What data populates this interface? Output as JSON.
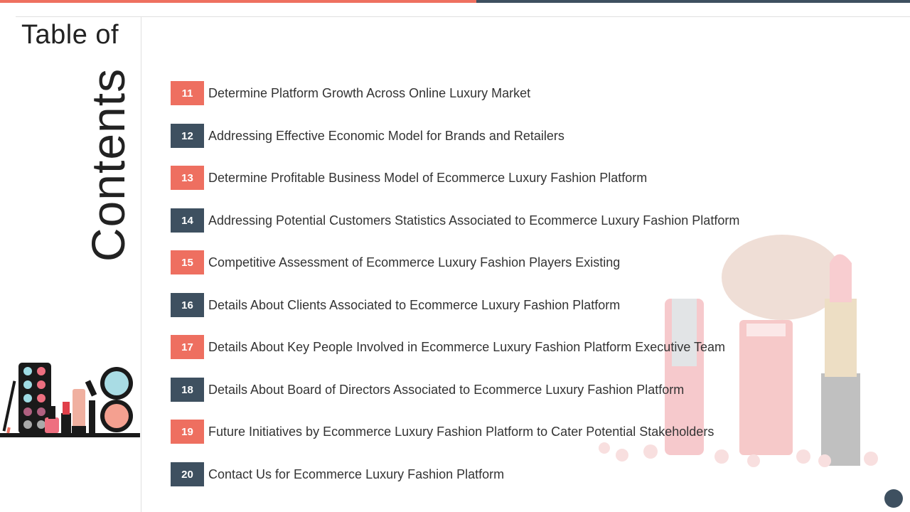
{
  "title": {
    "line1": "Table of",
    "line2": "Contents"
  },
  "colors": {
    "accent": "#ee6f60",
    "dark": "#3e5060"
  },
  "items": [
    {
      "num": "11",
      "text": "Determine Platform Growth Across Online Luxury Market",
      "color": "coral"
    },
    {
      "num": "12",
      "text": "Addressing Effective Economic Model for Brands and Retailers",
      "color": "navy"
    },
    {
      "num": "13",
      "text": "Determine Profitable Business Model of Ecommerce Luxury Fashion Platform",
      "color": "coral"
    },
    {
      "num": "14",
      "text": "Addressing Potential Customers Statistics Associated to Ecommerce Luxury Fashion Platform",
      "color": "navy"
    },
    {
      "num": "15",
      "text": "Competitive Assessment of Ecommerce Luxury Fashion Players Existing",
      "color": "coral"
    },
    {
      "num": "16",
      "text": "Details About Clients Associated to Ecommerce Luxury Fashion Platform",
      "color": "navy"
    },
    {
      "num": "17",
      "text": "Details About Key People Involved in Ecommerce Luxury Fashion Platform Executive Team",
      "color": "coral"
    },
    {
      "num": "18",
      "text": "Details About Board of Directors Associated to Ecommerce Luxury Fashion Platform",
      "color": "navy"
    },
    {
      "num": "19",
      "text": "Future Initiatives by Ecommerce Luxury Fashion Platform to Cater Potential Stakeholders",
      "color": "coral"
    },
    {
      "num": "20",
      "text": "Contact Us for Ecommerce Luxury Fashion Platform",
      "color": "navy"
    }
  ]
}
